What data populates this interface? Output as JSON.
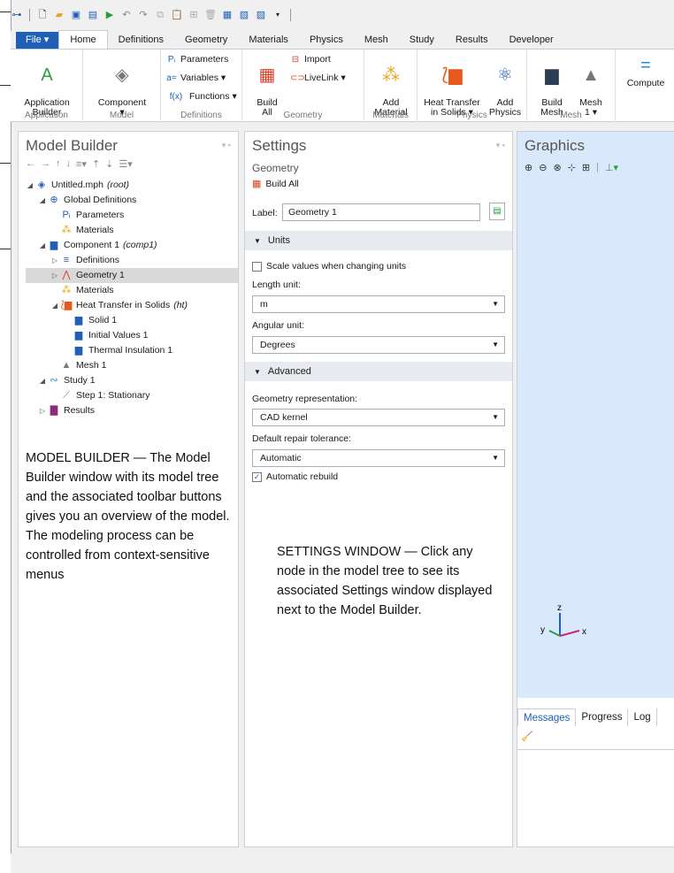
{
  "qat": {
    "icons": [
      "app-menu-icon",
      "new-icon",
      "open-icon",
      "save-icon",
      "save-as-icon",
      "run-icon",
      "undo-icon",
      "redo-icon",
      "copy-icon",
      "paste-icon",
      "duplicate-icon",
      "delete-icon",
      "settings-icon",
      "model-icon",
      "window-icon"
    ]
  },
  "tabs": [
    {
      "label": "File ▾"
    },
    {
      "label": "Home"
    },
    {
      "label": "Definitions"
    },
    {
      "label": "Geometry"
    },
    {
      "label": "Materials"
    },
    {
      "label": "Physics"
    },
    {
      "label": "Mesh"
    },
    {
      "label": "Study"
    },
    {
      "label": "Results"
    },
    {
      "label": "Developer"
    }
  ],
  "ribbon": {
    "groups": {
      "application": "Application",
      "model": "Model",
      "definitions": "Definitions",
      "geometry": "Geometry",
      "materials": "Materials",
      "physics": "Physics",
      "mesh": "Mesh"
    },
    "app_builder": "Application\nBuilder",
    "component": "Component\n▾",
    "parameters": "Parameters",
    "variables": "Variables ▾",
    "functions": "Functions ▾",
    "build_all": "Build\nAll",
    "import": "Import",
    "livelink": "LiveLink ▾",
    "add_material": "Add\nMaterial",
    "heat_transfer": "Heat Transfer\nin Solids ▾",
    "add_physics": "Add\nPhysics",
    "build_mesh": "Build\nMesh",
    "mesh1": "Mesh\n1 ▾",
    "compute": "Compute"
  },
  "colors": {
    "accent": "#1f5fb5",
    "graphics_bg": "#d9e9fb",
    "section_bg": "#e7ebf0"
  },
  "model_builder": {
    "title": "Model Builder",
    "tree": [
      {
        "label": "Untitled.mph",
        "tag": "(root)",
        "icon": "model-icon",
        "level": 0,
        "toggle": "◢"
      },
      {
        "label": "Global Definitions",
        "tag": "",
        "icon": "globe-icon",
        "level": 1,
        "toggle": "◢"
      },
      {
        "label": "Parameters",
        "tag": "",
        "icon": "parameters-icon",
        "level": 2,
        "toggle": ""
      },
      {
        "label": "Materials",
        "tag": "",
        "icon": "materials-icon",
        "level": 2,
        "toggle": ""
      },
      {
        "label": "Component 1",
        "tag": "(comp1)",
        "icon": "component-icon",
        "level": 1,
        "toggle": "◢"
      },
      {
        "label": "Definitions",
        "tag": "",
        "icon": "definitions-icon",
        "level": 2,
        "toggle": "▷"
      },
      {
        "label": "Geometry 1",
        "tag": "",
        "icon": "geometry-icon",
        "level": 2,
        "toggle": "▷",
        "selected": true
      },
      {
        "label": "Materials",
        "tag": "",
        "icon": "materials-icon",
        "level": 2,
        "toggle": ""
      },
      {
        "label": "Heat Transfer in Solids",
        "tag": "(ht)",
        "icon": "heat-transfer-icon",
        "level": 2,
        "toggle": "◢"
      },
      {
        "label": "Solid 1",
        "tag": "",
        "icon": "solid-icon",
        "level": 3,
        "toggle": ""
      },
      {
        "label": "Initial Values 1",
        "tag": "",
        "icon": "initial-values-icon",
        "level": 3,
        "toggle": ""
      },
      {
        "label": "Thermal Insulation 1",
        "tag": "",
        "icon": "thermal-insulation-icon",
        "level": 3,
        "toggle": ""
      },
      {
        "label": "Mesh 1",
        "tag": "",
        "icon": "mesh-icon",
        "level": 2,
        "toggle": ""
      },
      {
        "label": "Study 1",
        "tag": "",
        "icon": "study-icon",
        "level": 1,
        "toggle": "◢"
      },
      {
        "label": "Step 1: Stationary",
        "tag": "",
        "icon": "step-icon",
        "level": 2,
        "toggle": ""
      },
      {
        "label": "Results",
        "tag": "",
        "icon": "results-icon",
        "level": 1,
        "toggle": "▷"
      }
    ],
    "note": "MODEL BUILDER — The Model Builder window with its model tree and the associated toolbar buttons gives you an overview of the model. The modeling process can be controlled from context-sensitive menus"
  },
  "settings": {
    "title": "Settings",
    "subtitle": "Geometry",
    "build_all": "Build All",
    "label_caption": "Label:",
    "label_value": "Geometry 1",
    "units_section": "Units",
    "scale_values": "Scale values when changing units",
    "length_unit_label": "Length unit:",
    "length_unit": "m",
    "angular_unit_label": "Angular unit:",
    "angular_unit": "Degrees",
    "advanced_section": "Advanced",
    "geom_rep_label": "Geometry representation:",
    "geom_rep": "CAD kernel",
    "repair_label": "Default repair tolerance:",
    "repair": "Automatic",
    "auto_rebuild": "Automatic rebuild",
    "note": "SETTINGS WINDOW — Click any node in the model tree to see its associated Settings window displayed next to the Model Builder."
  },
  "graphics": {
    "title": "Graphics",
    "axis_x": "x",
    "axis_y": "y",
    "axis_z": "z"
  },
  "messages": {
    "tabs": [
      {
        "label": "Messages"
      },
      {
        "label": "Progress"
      },
      {
        "label": "Log"
      }
    ]
  }
}
